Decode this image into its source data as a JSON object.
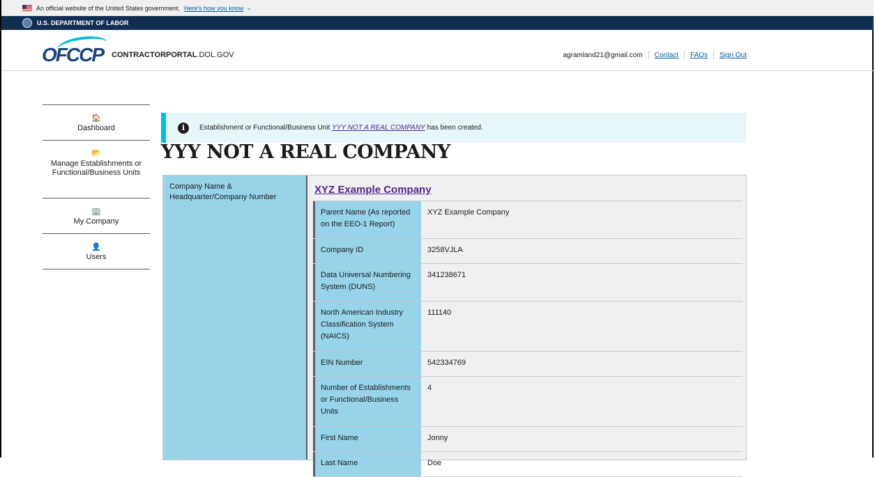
{
  "banner": {
    "text": "An official website of the United States government.",
    "link": "Here's how you know",
    "chevron": "⌄"
  },
  "agency": {
    "name": "U.S. DEPARTMENT OF LABOR"
  },
  "header": {
    "logo_text": "OFCCP",
    "portal_bold": "CONTRACTORPORTAL",
    "portal_rest": ".DOL.GOV",
    "user_email": "agramland21@gmail.com",
    "contact_label": "Contact",
    "faqs_label": "FAQs",
    "signout_label": "Sign Out"
  },
  "sidebar": {
    "items": [
      {
        "label": "Dashboard",
        "icon": "home-icon",
        "glyph": "🏠"
      },
      {
        "label": "Manage Establishments or Functional/Business Units",
        "icon": "folder-open-icon",
        "glyph": "📂"
      },
      {
        "label": "My Company",
        "icon": "building-icon",
        "glyph": "🏢"
      },
      {
        "label": "Users",
        "icon": "user-icon",
        "glyph": "👤"
      }
    ]
  },
  "alert": {
    "prefix": "Establishment or Functional/Business Unit",
    "link": "YYY NOT A REAL COMPANY",
    "suffix": "has been created."
  },
  "page": {
    "title": "YYY NOT A REAL COMPANY"
  },
  "company": {
    "label": "Company Name & Headquarter/Company Number",
    "name": "XYZ Example Company",
    "rows": [
      {
        "key": "Parent Name (As reported on the EEO-1 Report)",
        "value": "XYZ Example Company"
      },
      {
        "key": "Company ID",
        "value": "3258VJLA"
      },
      {
        "key": "Data Universal Numbering System (DUNS)",
        "value": "341238671"
      },
      {
        "key": "North American Industry Classification System (NAICS)",
        "value": "111140"
      },
      {
        "key": "EIN Number",
        "value": "542334769"
      },
      {
        "key": "Number of Establishments or Functional/Business Units",
        "value": "4"
      },
      {
        "key": "First Name",
        "value": "Jonny"
      },
      {
        "key": "Last Name",
        "value": "Doe"
      }
    ]
  },
  "colors": {
    "dol_blue": "#112e51",
    "link_blue": "#005ea2",
    "visited_purple": "#54278f",
    "alert_cyan": "#00bde3",
    "label_blue": "#97d4ea"
  }
}
